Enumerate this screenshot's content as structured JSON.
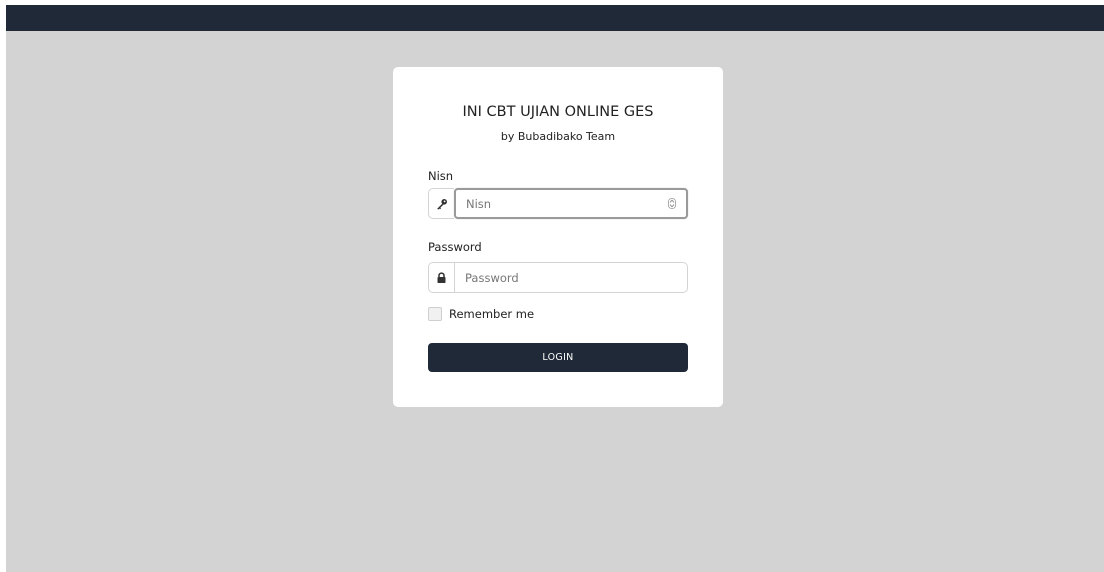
{
  "login": {
    "title": "INI CBT UJIAN ONLINE GES",
    "subtitle": "by Bubadibako Team",
    "nisn": {
      "label": "Nisn",
      "placeholder": "Nisn",
      "icon": "key-icon",
      "value": ""
    },
    "password": {
      "label": "Password",
      "placeholder": "Password",
      "icon": "lock-icon",
      "value": ""
    },
    "remember": {
      "label": "Remember me",
      "checked": false
    },
    "button_label": "LOGIN"
  },
  "colors": {
    "topbar": "#1f2937",
    "background": "#d3d3d3",
    "button": "#1f2937"
  }
}
